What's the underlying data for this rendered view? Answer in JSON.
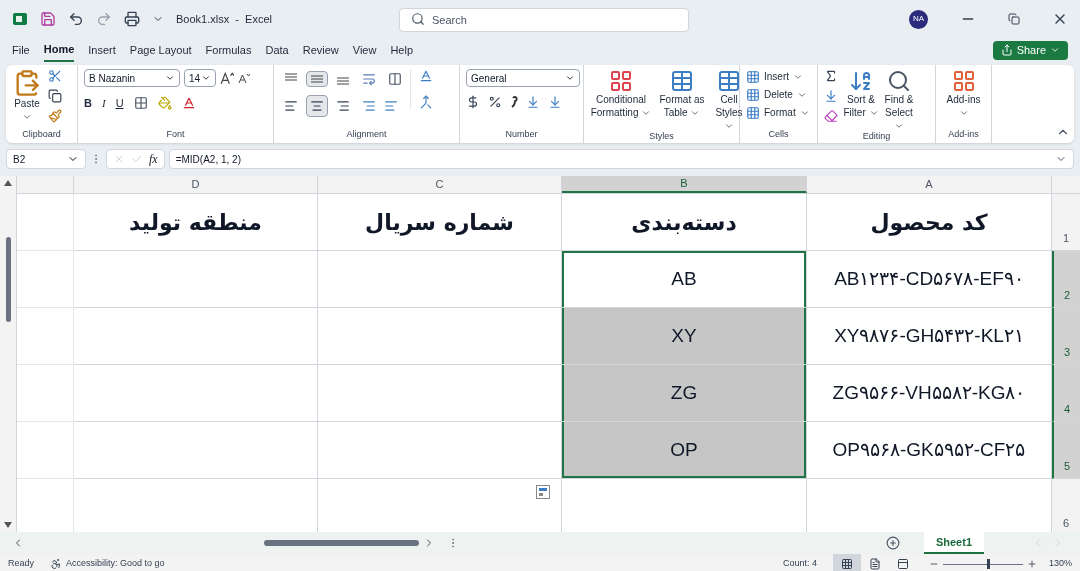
{
  "window": {
    "file_title": "Book1.xlsx  -  Excel",
    "search_placeholder": "Search",
    "avatar": "NA"
  },
  "menu_tabs": [
    {
      "label": "File",
      "selected": false
    },
    {
      "label": "Home",
      "selected": true
    },
    {
      "label": "Insert",
      "selected": false
    },
    {
      "label": "Page Layout",
      "selected": false
    },
    {
      "label": "Formulas",
      "selected": false
    },
    {
      "label": "Data",
      "selected": false
    },
    {
      "label": "Review",
      "selected": false
    },
    {
      "label": "View",
      "selected": false
    },
    {
      "label": "Help",
      "selected": false
    }
  ],
  "share_button": "Share",
  "ribbon": {
    "clipboard": {
      "paste": "Paste",
      "label": "Clipboard"
    },
    "font": {
      "name": "B Nazanin",
      "size": "14",
      "bold": "B",
      "italic": "I",
      "underline": "U",
      "label": "Font"
    },
    "alignment": {
      "vertical": [
        {
          "kind": "top",
          "selected": false
        },
        {
          "kind": "middle",
          "selected": true
        },
        {
          "kind": "bottom",
          "selected": false
        }
      ],
      "horizontal": [
        {
          "kind": "left",
          "selected": false
        },
        {
          "kind": "center",
          "selected": true
        },
        {
          "kind": "right",
          "selected": false
        }
      ],
      "label": "Alignment"
    },
    "number": {
      "format": "General",
      "label": "Number"
    },
    "styles": {
      "buttons": [
        "Conditional Formatting",
        "Format as Table",
        "Cell Styles"
      ],
      "label": "Styles"
    },
    "cells": {
      "buttons": [
        "Insert",
        "Delete",
        "Format"
      ],
      "label": "Cells"
    },
    "editing": {
      "buttons": [
        "Sort & Filter",
        "Find & Select"
      ],
      "label": "Editing"
    },
    "addins": {
      "button": "Add-ins",
      "label": "Add-ins"
    }
  },
  "formula_bar": {
    "name_box": "B2",
    "fx": "fx",
    "formula": "=MID(A2, 1, 2)"
  },
  "sheet": {
    "columns": [
      {
        "label": "D",
        "selected": false
      },
      {
        "label": "C",
        "selected": false
      },
      {
        "label": "B",
        "selected": true
      },
      {
        "label": "A",
        "selected": false
      }
    ],
    "rows": [
      {
        "number": "1",
        "kind": "header",
        "selected": false,
        "cells": [
          {
            "text": "منطقه تولید",
            "selected": false,
            "active": false
          },
          {
            "text": "شماره سریال",
            "selected": false,
            "active": false
          },
          {
            "text": "دسته‌بندی",
            "selected": false,
            "active": false
          },
          {
            "text": "کد محصول",
            "selected": false,
            "active": false
          }
        ]
      },
      {
        "number": "2",
        "kind": "data",
        "selected": true,
        "cells": [
          {
            "selected": false,
            "active": false
          },
          {
            "selected": false,
            "active": false
          },
          {
            "text": "AB",
            "selected": true,
            "active": true
          },
          {
            "text": "AB۱۲۳۴-CD۵۶۷۸-EF۹۰",
            "selected": false,
            "active": false
          }
        ]
      },
      {
        "number": "3",
        "kind": "data",
        "selected": true,
        "cells": [
          {
            "selected": false,
            "active": false
          },
          {
            "selected": false,
            "active": false
          },
          {
            "text": "XY",
            "selected": true,
            "active": false
          },
          {
            "text": "XY۹۸۷۶-GH۵۴۳۲-KL۲۱",
            "selected": false,
            "active": false
          }
        ]
      },
      {
        "number": "4",
        "kind": "data",
        "selected": true,
        "cells": [
          {
            "selected": false,
            "active": false
          },
          {
            "selected": false,
            "active": false
          },
          {
            "text": "ZG",
            "selected": true,
            "active": false
          },
          {
            "text": "ZG۹۵۶۶-VH۵۵۸۲-KG۸۰",
            "selected": false,
            "active": false
          }
        ]
      },
      {
        "number": "5",
        "kind": "data",
        "selected": true,
        "cells": [
          {
            "selected": false,
            "active": false
          },
          {
            "selected": false,
            "active": false
          },
          {
            "text": "OP",
            "selected": true,
            "active": false
          },
          {
            "text": "OP۹۵۶۸-GK۵۹۵۲-CF۲۵",
            "selected": false,
            "active": false
          }
        ]
      },
      {
        "number": "6",
        "kind": "data",
        "selected": false,
        "cells": [
          {
            "selected": false,
            "active": false
          },
          {
            "selected": false,
            "active": false
          },
          {
            "selected": false,
            "active": false
          },
          {
            "selected": false,
            "active": false
          }
        ]
      }
    ]
  },
  "sheet_tabs": [
    {
      "label": "Sheet1",
      "selected": true
    }
  ],
  "status_bar": {
    "ready": "Ready",
    "accessibility": "Accessibility: Good to go",
    "count": "Count: 4",
    "views": [
      {
        "kind": "normal",
        "selected": true
      },
      {
        "kind": "page-layout",
        "selected": false
      },
      {
        "kind": "page-break",
        "selected": false
      }
    ],
    "zoom_slider": {
      "level": 0.57
    },
    "zoom": "130%"
  }
}
